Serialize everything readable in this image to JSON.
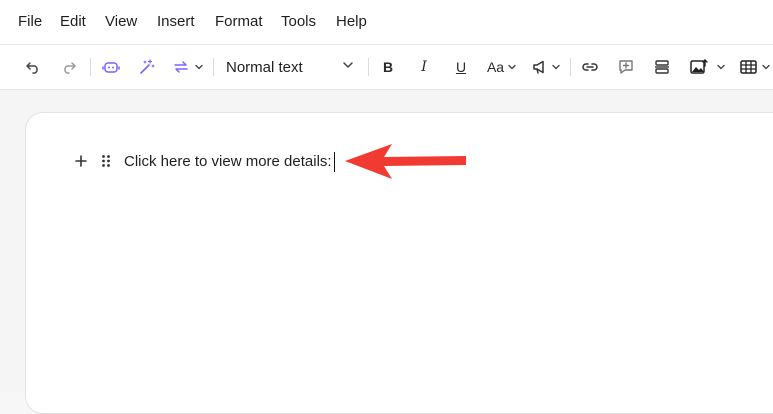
{
  "menubar": {
    "items": [
      "File",
      "Edit",
      "View",
      "Insert",
      "Format",
      "Tools",
      "Help"
    ]
  },
  "toolbar": {
    "undo_icon": "undo-icon",
    "redo_icon": "redo-icon",
    "ai_assistant_icon": "robot-icon",
    "magic_icon": "magic-wand-icon",
    "convert_icon": "swap-arrows-icon",
    "text_style": "Normal text",
    "bold": "B",
    "italic": "I",
    "underline": "U",
    "text_size": "Aa",
    "announce_icon": "megaphone-icon",
    "link_icon": "link-icon",
    "comment_icon": "add-comment-icon",
    "layout_icon": "layout-icon",
    "image_icon": "image-upload-icon",
    "table_icon": "table-icon",
    "accent_color": "#7b61ff"
  },
  "document": {
    "paragraph_text": "Click here to view more details:"
  },
  "annotation": {
    "arrow_color": "#f03a32"
  }
}
